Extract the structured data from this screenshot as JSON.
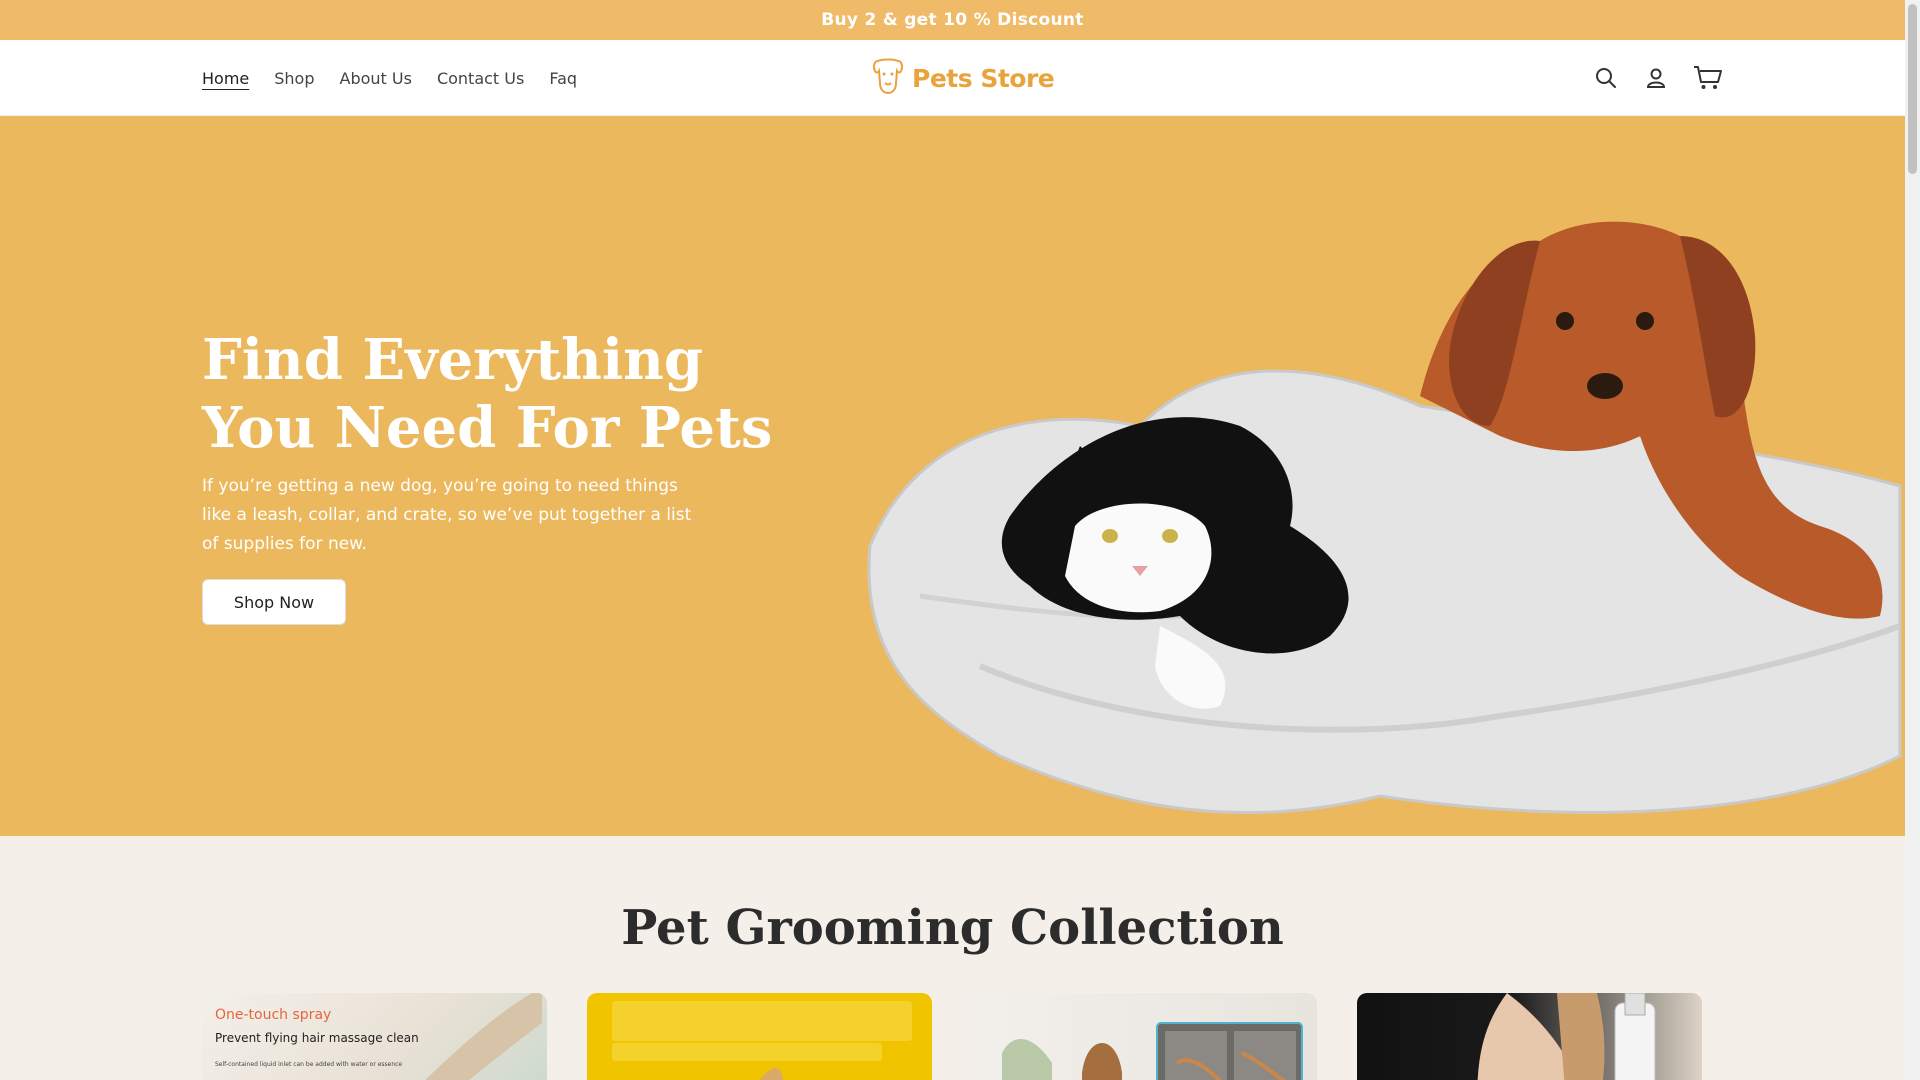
{
  "announcement": {
    "text": "Buy 2 & get 10 % Discount"
  },
  "nav": {
    "items": [
      {
        "label": "Home",
        "active": true
      },
      {
        "label": "Shop"
      },
      {
        "label": "About Us"
      },
      {
        "label": "Contact Us"
      },
      {
        "label": "Faq"
      }
    ]
  },
  "logo": {
    "text": "Pets Store",
    "icon": "dog-icon"
  },
  "header_icons": {
    "search": "search-icon",
    "account": "user-icon",
    "cart": "cart-icon"
  },
  "hero": {
    "title": "Find Everything You Need For Pets",
    "description": "If you’re getting a new dog, you’re going to need things like a leash, collar, and crate, so we’ve put together a list of supplies for new.",
    "button_label": "Shop Now"
  },
  "collection": {
    "title": "Pet Grooming Collection",
    "cards": [
      {
        "heading": "One-touch spray",
        "subheading": "Prevent flying hair massage clean",
        "fine_print": "Self-contained liquid inlet can be added with water or essence"
      },
      {
        "heading": ""
      },
      {
        "heading": ""
      },
      {
        "heading": ""
      }
    ]
  },
  "colors": {
    "accent": "#f0bb69",
    "hero_bg": "#ebb85d",
    "logo": "#e8a33c"
  }
}
